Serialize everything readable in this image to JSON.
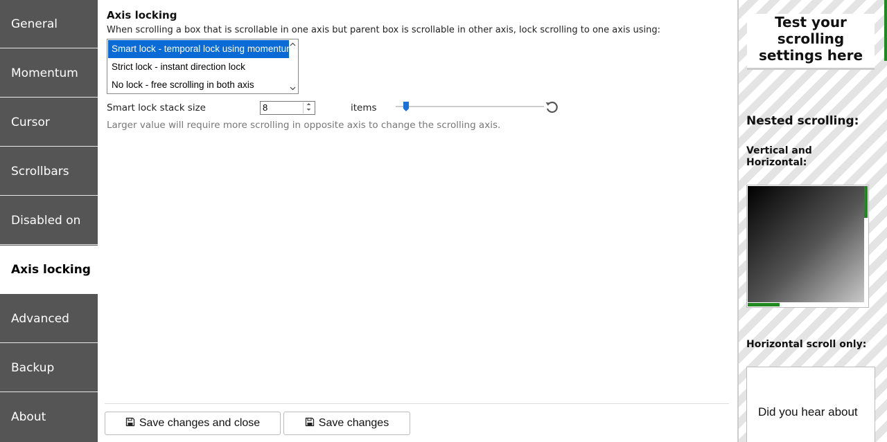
{
  "sidebar": {
    "items": [
      {
        "label": "General"
      },
      {
        "label": "Momentum"
      },
      {
        "label": "Cursor"
      },
      {
        "label": "Scrollbars"
      },
      {
        "label": "Disabled on"
      },
      {
        "label": "Axis locking"
      },
      {
        "label": "Advanced"
      },
      {
        "label": "Backup"
      },
      {
        "label": "About"
      }
    ],
    "active": "Axis locking"
  },
  "main": {
    "title": "Axis locking",
    "description": "When scrolling a box that is scrollable in one axis but parent box is scrollable in other axis, lock scrolling to one axis using:",
    "lock_options": [
      {
        "label": "Smart lock - temporal lock using momentum",
        "selected": true
      },
      {
        "label": "Strict lock - instant direction lock",
        "selected": false
      },
      {
        "label": "No lock - free scrolling in both axis",
        "selected": false
      }
    ],
    "stack_size": {
      "label": "Smart lock stack size",
      "value": "8",
      "unit": "items",
      "slider_fraction": 0.03
    },
    "hint": "Larger value will require more scrolling in opposite axis to change the scrolling axis."
  },
  "footer": {
    "save_close_label": "Save changes and close",
    "save_label": "Save changes"
  },
  "test_panel": {
    "title": "Test your scrolling settings here",
    "nested_heading": "Nested scrolling:",
    "vh_heading": "Vertical and Horizontal:",
    "horizontal_heading": "Horizontal scroll only:",
    "horizontal_text": "Did you hear about"
  },
  "colors": {
    "sidebar_bg": "#555555",
    "selection": "#0a6bd6",
    "scrollbar_accent": "#1f8a1f"
  }
}
